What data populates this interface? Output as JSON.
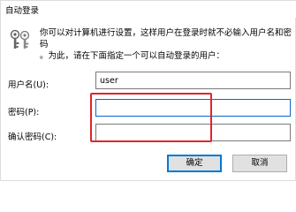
{
  "window": {
    "title": "自动登录"
  },
  "description": {
    "line1": "你可以对计算机进行设置，这样用户在登录时就不必输入用户名和密码",
    "line2": "。为此，请在下面指定一个可以自动登录的用户："
  },
  "form": {
    "username_label": "用户名(U):",
    "username_value": "user",
    "password_label": "密码(P):",
    "password_value": "",
    "confirm_label": "确认密码(C):",
    "confirm_value": ""
  },
  "buttons": {
    "ok": "确定",
    "cancel": "取消"
  },
  "colors": {
    "highlight": "#e0252b",
    "focus": "#0078d7"
  },
  "icons": {
    "dialog": "keys-icon"
  }
}
